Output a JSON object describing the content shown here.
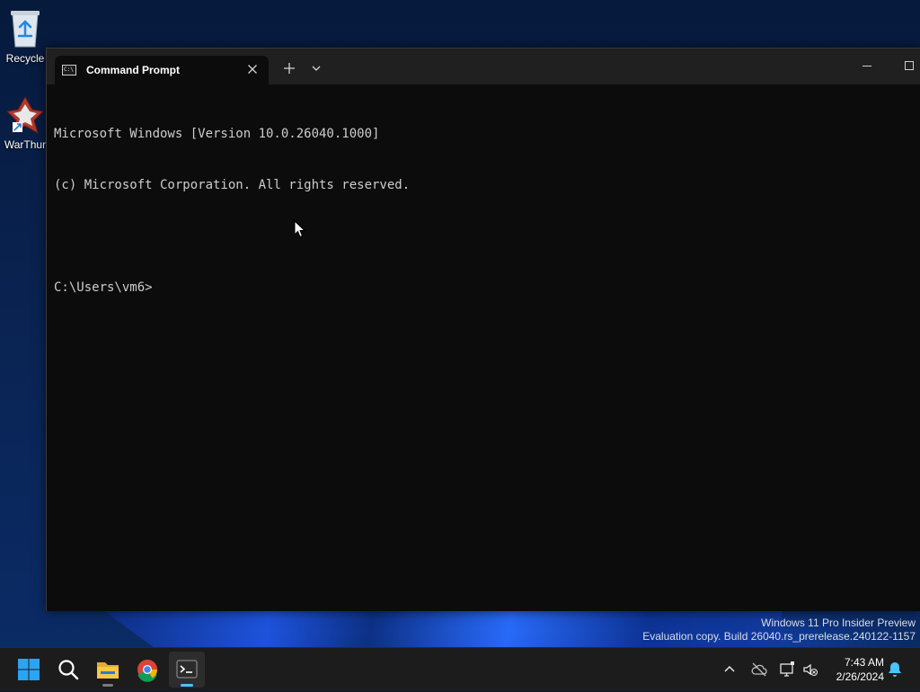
{
  "desktop": {
    "icons": [
      {
        "label": "Recycle"
      },
      {
        "label": "WarThur"
      }
    ],
    "watermark": {
      "line1": "Windows 11 Pro Insider Preview",
      "line2": "Evaluation copy. Build 26040.rs_prerelease.240122-1157"
    }
  },
  "terminal": {
    "tab_title": "Command Prompt",
    "tab_icon": "command-prompt-icon",
    "console_lines": [
      "Microsoft Windows [Version 10.0.26040.1000]",
      "(c) Microsoft Corporation. All rights reserved.",
      "",
      "C:\\Users\\vm6>"
    ]
  },
  "taskbar": {
    "apps": [
      {
        "name": "start",
        "icon": "windows-logo-icon"
      },
      {
        "name": "search",
        "icon": "search-icon"
      },
      {
        "name": "file-explorer",
        "icon": "folder-icon"
      },
      {
        "name": "chrome",
        "icon": "chrome-icon"
      },
      {
        "name": "terminal",
        "icon": "terminal-icon",
        "active": true
      }
    ],
    "tray": {
      "time": "7:43 AM",
      "date": "2/26/2024"
    }
  },
  "colors": {
    "accent": "#4cc2ff",
    "console_bg": "#0c0c0c",
    "console_fg": "#cccccc",
    "titlebar": "#202020",
    "taskbar": "#1c1c1c"
  }
}
